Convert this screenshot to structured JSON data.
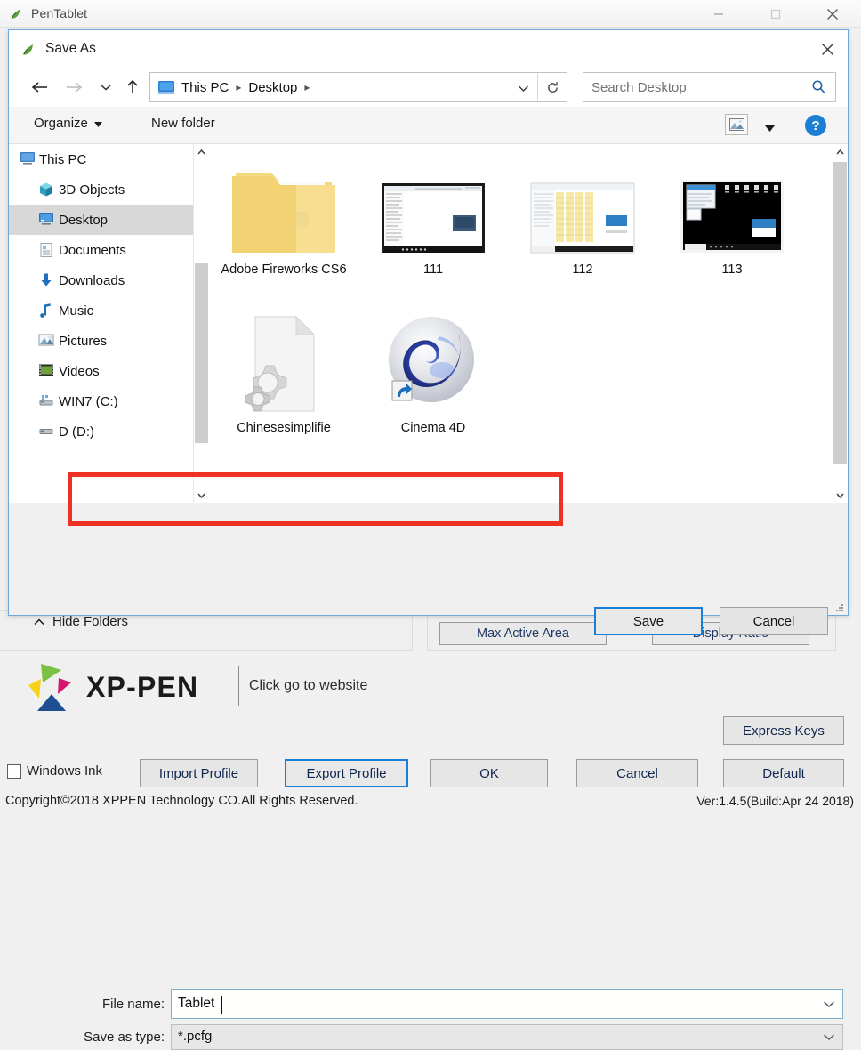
{
  "app": {
    "title": "PenTablet",
    "icon": "pen-tablet-icon",
    "window_buttons": {
      "minimize": "minimize-icon",
      "maximize": "maximize-icon",
      "close": "close-icon"
    },
    "background_buttons": [
      {
        "label": "Max Active Area"
      },
      {
        "label": "Display Ratio"
      }
    ],
    "brand": {
      "wordmark": "XP-PEN",
      "link_text": "Click go to website",
      "logo_colors": {
        "green": "#7ac143",
        "magenta": "#d6176e",
        "yellow": "#f5d216",
        "blue": "#1d4f91"
      }
    },
    "bottom_bar": {
      "express_keys": "Express Keys",
      "windows_ink": "Windows Ink",
      "windows_ink_checked": false,
      "import_profile": "Import Profile",
      "export_profile": "Export Profile",
      "ok": "OK",
      "cancel": "Cancel",
      "default": "Default"
    },
    "copyright": "Copyright©2018  XPPEN Technology CO.All Rights Reserved.",
    "version": "Ver:1.4.5(Build:Apr 24 2018)"
  },
  "dialog": {
    "title": "Save As",
    "icon": "pen-tablet-icon",
    "close_label": "close-icon",
    "nav": {
      "back": "back-arrow-icon",
      "forward": "forward-arrow-icon",
      "recent": "recent-locations-icon",
      "up": "up-arrow-icon",
      "refresh": "refresh-icon",
      "breadcrumbs": [
        "This PC",
        "Desktop"
      ],
      "path_icon": "this-pc-icon"
    },
    "search": {
      "placeholder": "Search Desktop",
      "icon": "search-icon"
    },
    "commandbar": {
      "organize": "Organize",
      "new_folder": "New folder",
      "view_icon": "view-layout-icon",
      "help": "?"
    },
    "nav_pane": {
      "items": [
        {
          "label": "This PC",
          "icon": "this-pc-icon",
          "level": 0,
          "selected": false
        },
        {
          "label": "3D Objects",
          "icon": "3d-objects-icon",
          "level": 1,
          "selected": false
        },
        {
          "label": "Desktop",
          "icon": "desktop-icon",
          "level": 1,
          "selected": true
        },
        {
          "label": "Documents",
          "icon": "documents-icon",
          "level": 1,
          "selected": false
        },
        {
          "label": "Downloads",
          "icon": "downloads-icon",
          "level": 1,
          "selected": false
        },
        {
          "label": "Music",
          "icon": "music-icon",
          "level": 1,
          "selected": false
        },
        {
          "label": "Pictures",
          "icon": "pictures-icon",
          "level": 1,
          "selected": false
        },
        {
          "label": "Videos",
          "icon": "videos-icon",
          "level": 1,
          "selected": false
        },
        {
          "label": "WIN7 (C:)",
          "icon": "hard-drive-icon",
          "level": 1,
          "selected": false
        },
        {
          "label": "D (D:)",
          "icon": "hard-drive-icon",
          "level": 1,
          "selected": false
        }
      ]
    },
    "files": [
      {
        "label": "Adobe Fireworks CS6",
        "icon": "folder-icon"
      },
      {
        "label": "111",
        "icon": "screenshot-thumbnail-dark"
      },
      {
        "label": "112",
        "icon": "screenshot-thumbnail-light"
      },
      {
        "label": "113",
        "icon": "screenshot-thumbnail-black"
      },
      {
        "label": "Chinesesimplifie",
        "icon": "config-file-icon"
      },
      {
        "label": "Cinema 4D",
        "icon": "cinema4d-shortcut-icon"
      }
    ],
    "form": {
      "filename_label": "File name:",
      "filename_value": "Tablet",
      "savetype_label": "Save as type:",
      "savetype_value": "*.pcfg"
    },
    "footer": {
      "hide_folders": "Hide Folders",
      "save": "Save",
      "cancel": "Cancel"
    },
    "annotation": {
      "color": "#ef3124",
      "target": "file-name-field"
    }
  }
}
